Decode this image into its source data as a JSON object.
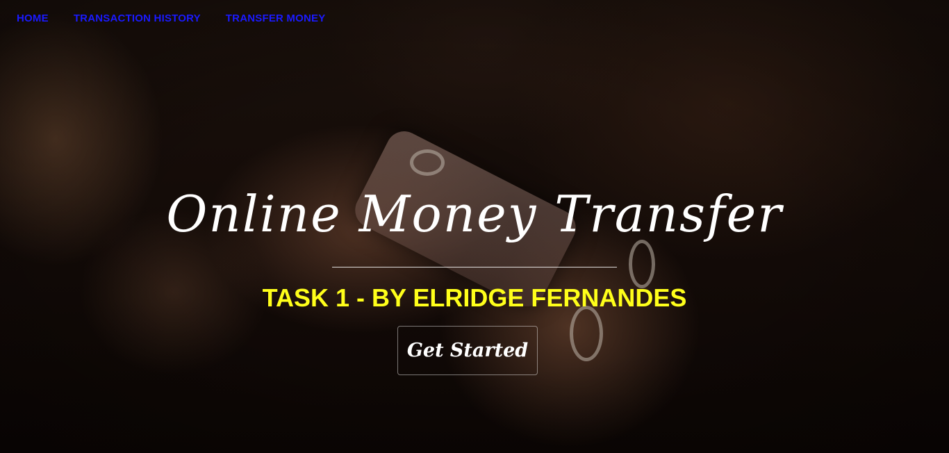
{
  "nav": {
    "items": [
      {
        "label": "HOME"
      },
      {
        "label": "TRANSACTION HISTORY"
      },
      {
        "label": "TRANSFER MONEY"
      }
    ]
  },
  "hero": {
    "title": "Online Money Transfer",
    "subtitle": "TASK 1 - BY ELRIDGE FERNANDES",
    "cta_label": "Get Started"
  },
  "colors": {
    "nav_link": "#1a1aff",
    "title": "#ffffff",
    "subtitle": "#ffff1a",
    "cta_border": "#ffffff"
  },
  "background": {
    "description_icon": "photo-hands-holding-phone"
  }
}
